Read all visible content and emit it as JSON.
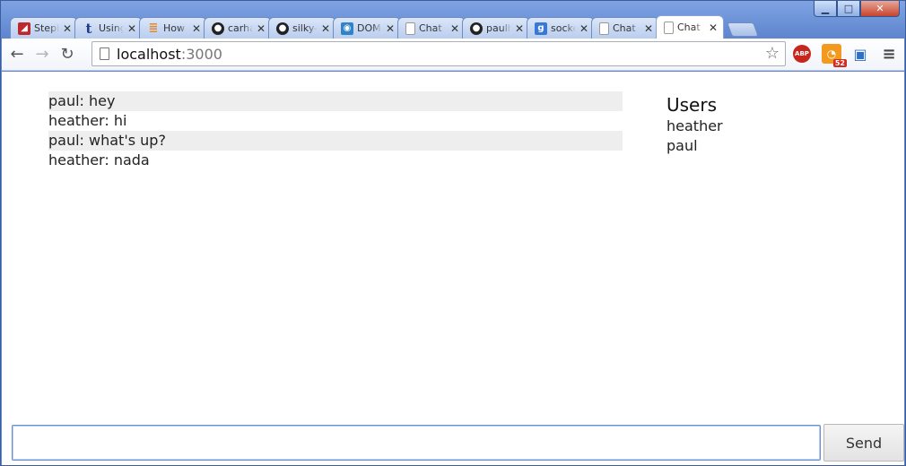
{
  "browser": {
    "tabs": [
      {
        "label": "Steph",
        "favicon": "app-icon",
        "color": "#c0272d"
      },
      {
        "label": "Using",
        "favicon": "tumblr-icon",
        "color": "#1f3a8a"
      },
      {
        "label": "How",
        "favicon": "stackoverflow-icon",
        "color": "#e0892e"
      },
      {
        "label": "carha",
        "favicon": "github-icon",
        "color": "#222222"
      },
      {
        "label": "silky-",
        "favicon": "github-icon",
        "color": "#222222"
      },
      {
        "label": "DOM",
        "favicon": "chat-bubble-icon",
        "color": "#2f84c8"
      },
      {
        "label": "Chat",
        "favicon": "page-icon",
        "color": "#bbbbbb"
      },
      {
        "label": "paulh",
        "favicon": "github-icon",
        "color": "#222222"
      },
      {
        "label": "socke",
        "favicon": "google-icon",
        "color": "#3a78d8"
      },
      {
        "label": "Chat",
        "favicon": "page-icon",
        "color": "#bbbbbb"
      },
      {
        "label": "Chat",
        "favicon": "page-icon",
        "color": "#bbbbbb",
        "active": true
      }
    ],
    "address": {
      "host": "localhost",
      "port": ":3000"
    },
    "extensions": {
      "abp_label": "ABP",
      "rss_badge": "52"
    }
  },
  "chat": {
    "messages": [
      {
        "text": "paul: hey"
      },
      {
        "text": "heather: hi"
      },
      {
        "text": "paul: what's up?"
      },
      {
        "text": "heather: nada"
      }
    ],
    "users_title": "Users",
    "users": [
      "heather",
      "paul"
    ],
    "input_value": "",
    "send_label": "Send"
  }
}
